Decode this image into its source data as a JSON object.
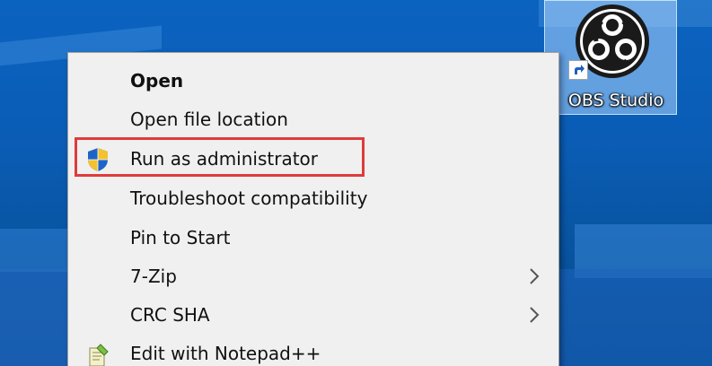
{
  "desktop": {
    "icon": {
      "label": "OBS Studio",
      "icon": "obs-studio-icon",
      "shortcut_overlay": "shortcut-arrow-icon",
      "selected": true
    }
  },
  "context_menu": {
    "items": [
      {
        "label": "Open",
        "bold": true,
        "icon": null,
        "submenu": false
      },
      {
        "label": "Open file location",
        "bold": false,
        "icon": null,
        "submenu": false
      },
      {
        "label": "Run as administrator",
        "bold": false,
        "icon": "uac-shield-icon",
        "submenu": false,
        "highlighted": true
      },
      {
        "label": "Troubleshoot compatibility",
        "bold": false,
        "icon": null,
        "submenu": false
      },
      {
        "label": "Pin to Start",
        "bold": false,
        "icon": null,
        "submenu": false
      },
      {
        "label": "7-Zip",
        "bold": false,
        "icon": null,
        "submenu": true
      },
      {
        "label": "CRC SHA",
        "bold": false,
        "icon": null,
        "submenu": true
      },
      {
        "label": "Edit with Notepad++",
        "bold": false,
        "icon": "notepad-plus-plus-icon",
        "submenu": false
      }
    ]
  },
  "colors": {
    "desktop_blue": "#0a5db5",
    "menu_background": "#f0f0f0",
    "highlight_border": "#e03b3b",
    "icon_selection": "#add6ff"
  }
}
